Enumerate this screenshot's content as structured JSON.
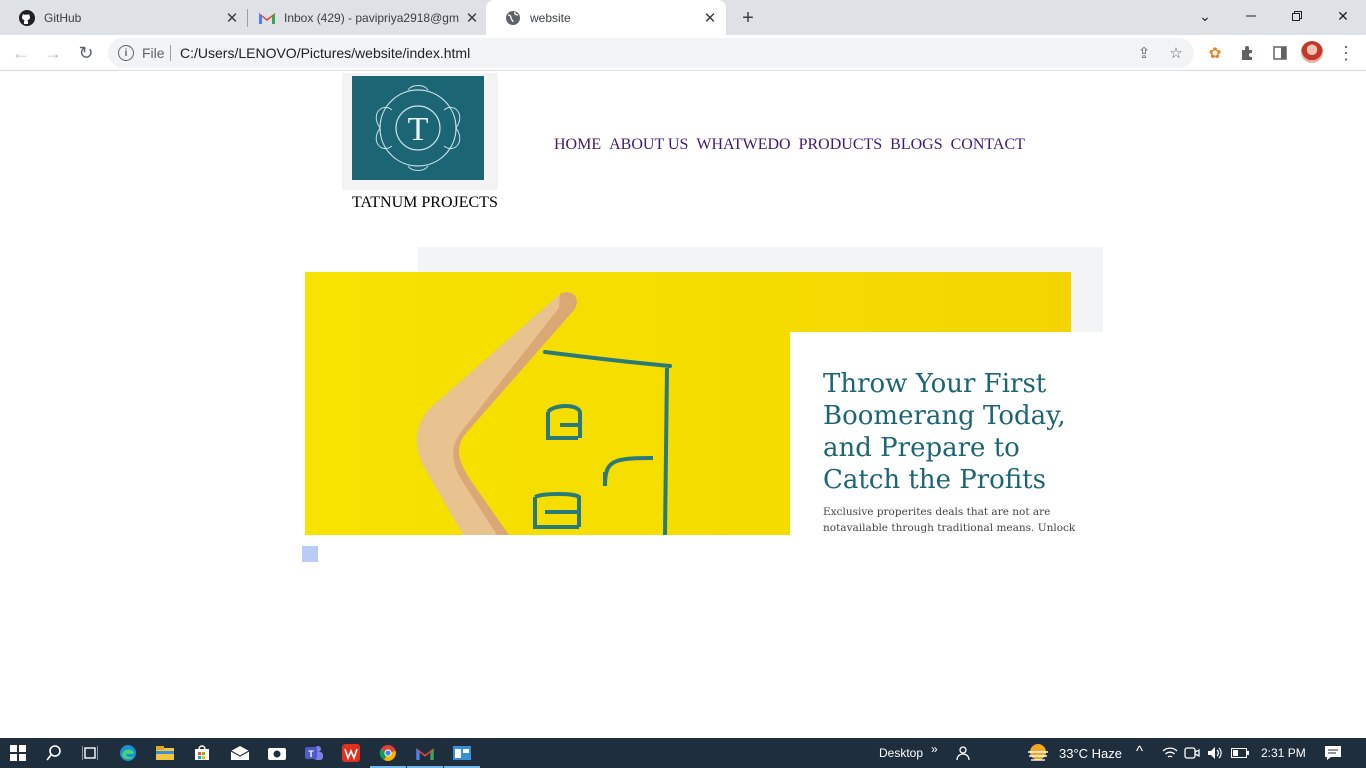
{
  "browser": {
    "tabs": [
      {
        "label": "GitHub",
        "icon": "github-icon"
      },
      {
        "label": "Inbox (429) - pavipriya2918@gm",
        "icon": "gmail-icon"
      },
      {
        "label": "website",
        "icon": "globe-icon"
      }
    ],
    "omnibox": {
      "scheme_label": "File",
      "url": "C:/Users/LENOVO/Pictures/website/index.html"
    }
  },
  "page": {
    "logo_letter": "T",
    "brand": "TATNUM PROJECTS",
    "nav": [
      "HOME",
      "ABOUT US",
      "WHATWEDO",
      "PRODUCTS",
      "BLOGS",
      "CONTACT"
    ],
    "hero": {
      "title": "Throw Your First Boomerang Today, and Prepare to Catch the Profits",
      "text": "Exclusive properites deals that are not are notavailable through traditional means. Unlock"
    }
  },
  "taskbar": {
    "desktop_label": "Desktop",
    "weather": "33°C  Haze",
    "time": "2:31 PM"
  },
  "colors": {
    "brand_teal": "#1b6575",
    "hero_yellow": "#f5dc00",
    "nav_purple": "#3d1a78"
  }
}
